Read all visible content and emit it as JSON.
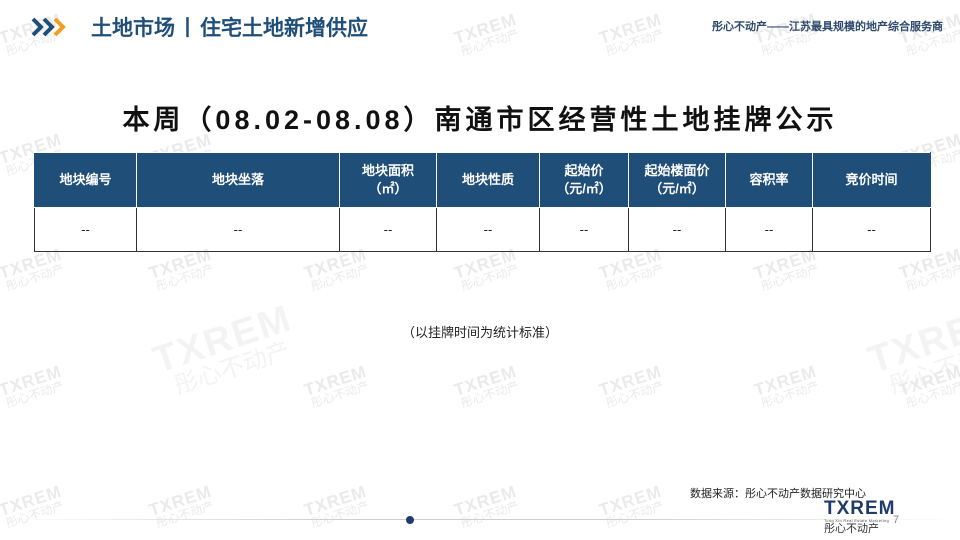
{
  "header": {
    "title_part1": "土地市场",
    "separator": "丨",
    "title_part2": "住宅土地新增供应",
    "slogan": "彤心不动产——江苏最具规模的地产综合服务商"
  },
  "main_title": "本周（08.02-08.08）南通市区经营性土地挂牌公示",
  "table": {
    "headers": [
      {
        "line1": "地块编号",
        "line2": ""
      },
      {
        "line1": "地块坐落",
        "line2": ""
      },
      {
        "line1": "地块面积",
        "line2": "（㎡）"
      },
      {
        "line1": "地块性质",
        "line2": ""
      },
      {
        "line1": "起始价",
        "line2": "（元/㎡）"
      },
      {
        "line1": "起始楼面价",
        "line2": "（元/㎡）"
      },
      {
        "line1": "容积率",
        "line2": ""
      },
      {
        "line1": "竞价时间",
        "line2": ""
      }
    ],
    "rows": [
      [
        "--",
        "--",
        "--",
        "--",
        "--",
        "--",
        "--",
        "--"
      ]
    ]
  },
  "note": "（以挂牌时间为统计标准）",
  "source": "数据来源：彤心不动产数据研究中心",
  "logo": {
    "mark": "TXREM",
    "tagline": "Tong Xin Real Estate Marketing",
    "chinese": "彤心不动产"
  },
  "watermark": {
    "mark": "TXREM",
    "chinese": "彤心不动产"
  },
  "page_number": "7",
  "colors": {
    "primary": "#1f4e79",
    "accent_orange": "#f0a020",
    "logo_red": "#c8102e"
  }
}
